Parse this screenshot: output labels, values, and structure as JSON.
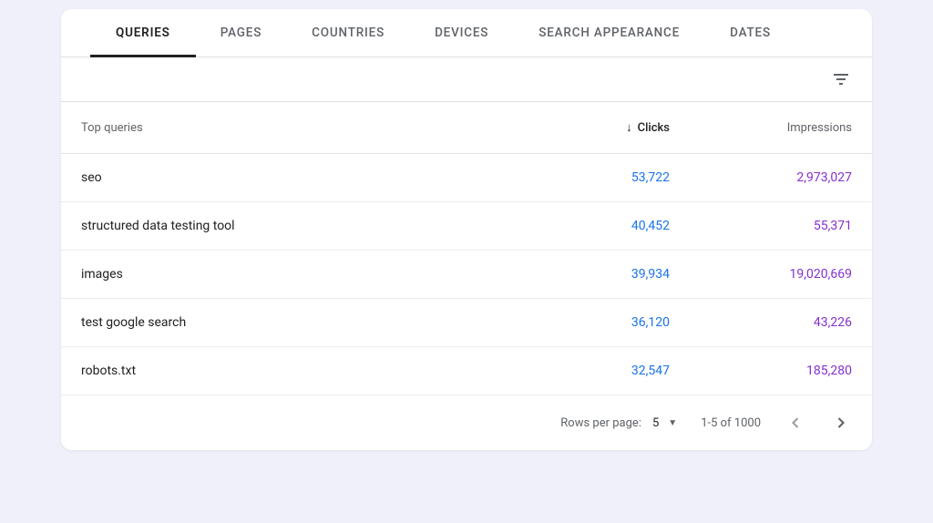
{
  "tabs": [
    {
      "label": "QUERIES",
      "active": true
    },
    {
      "label": "PAGES",
      "active": false
    },
    {
      "label": "COUNTRIES",
      "active": false
    },
    {
      "label": "DEVICES",
      "active": false
    },
    {
      "label": "SEARCH APPEARANCE",
      "active": false
    },
    {
      "label": "DATES",
      "active": false
    }
  ],
  "headers": {
    "query": "Top queries",
    "clicks": "Clicks",
    "impressions": "Impressions"
  },
  "rows": [
    {
      "query": "seo",
      "clicks": "53,722",
      "impressions": "2,973,027"
    },
    {
      "query": "structured data testing tool",
      "clicks": "40,452",
      "impressions": "55,371"
    },
    {
      "query": "images",
      "clicks": "39,934",
      "impressions": "19,020,669"
    },
    {
      "query": "test google search",
      "clicks": "36,120",
      "impressions": "43,226"
    },
    {
      "query": "robots.txt",
      "clicks": "32,547",
      "impressions": "185,280"
    }
  ],
  "footer": {
    "rows_per_page_label": "Rows per page:",
    "rows_per_page_value": "5",
    "range": "1-5 of 1000"
  }
}
